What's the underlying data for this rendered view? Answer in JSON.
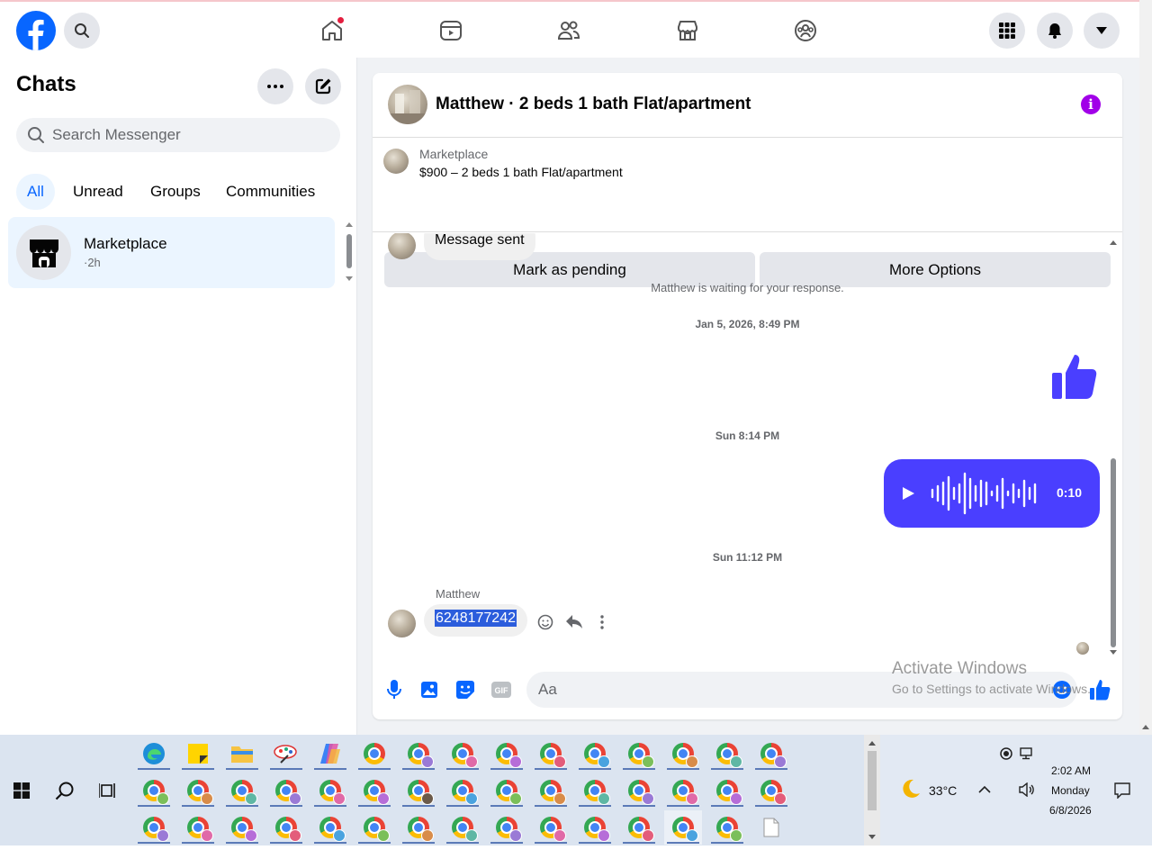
{
  "topbar": {
    "nav": [
      "home-icon",
      "watch-icon",
      "friends-icon",
      "marketplace-icon",
      "groups-icon"
    ],
    "right": [
      "menu-grid-icon",
      "bell-icon",
      "account-caret-icon"
    ]
  },
  "sidebar": {
    "title": "Chats",
    "search_placeholder": "Search Messenger",
    "filters": [
      "All",
      "Unread",
      "Groups",
      "Communities"
    ],
    "active_filter": "All",
    "chats": [
      {
        "name": "Marketplace",
        "time": "·2h"
      }
    ]
  },
  "conversation": {
    "title": "Matthew · 2 beds 1 bath Flat/apartment",
    "marketplace_label": "Marketplace",
    "listing": "$900 – 2 beds 1 bath Flat/apartment",
    "btn_pending": "Mark as pending",
    "btn_more": "More Options",
    "messages": {
      "prev_message": "Message sent",
      "waiting": "Matthew is waiting for your response.",
      "ts1": "Jan 5, 2026, 8:49 PM",
      "ts2": "Sun 8:14 PM",
      "audio_duration": "0:10",
      "ts3": "Sun 11:12 PM",
      "sender": "Matthew",
      "last_message": "6248177242"
    },
    "composer_placeholder": "Aa",
    "accent_color": "#4a3fff"
  },
  "watermark": {
    "line1": "Activate Windows",
    "line2": "Go to Settings to activate Windows."
  },
  "taskbar": {
    "weather": "33°C",
    "time": "2:02 AM",
    "day": "Monday",
    "date": "6/8/2026"
  }
}
